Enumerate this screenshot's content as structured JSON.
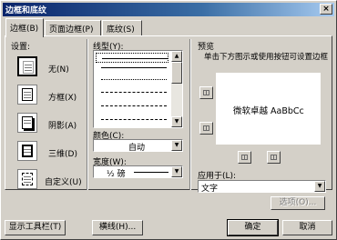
{
  "window": {
    "title": "边框和底纹",
    "close_glyph": "×"
  },
  "tabs": [
    {
      "label": "边框(B)"
    },
    {
      "label": "页面边框(P)"
    },
    {
      "label": "底纹(S)"
    }
  ],
  "settings": {
    "heading": "设置:",
    "items": [
      {
        "label": "无(N)"
      },
      {
        "label": "方框(X)"
      },
      {
        "label": "阴影(A)"
      },
      {
        "label": "三维(D)"
      },
      {
        "label": "自定义(U)"
      }
    ]
  },
  "line_style": {
    "label": "线型(Y):",
    "color_label": "颜色(C):",
    "color_value": "自动",
    "width_label": "宽度(W):",
    "width_value": "½ 磅"
  },
  "preview": {
    "heading": "预览",
    "hint": "单击下方图示或使用按钮可设置边框",
    "sample_text": "微软卓越 AaBbCc"
  },
  "apply_to": {
    "label": "应用于(L):",
    "value": "文字",
    "options_button": "选项(O)..."
  },
  "footer": {
    "toolbar_button": "显示工具栏(T)",
    "hline_button": "横线(H)...",
    "ok_button": "确定",
    "cancel_button": "取消"
  },
  "colors": {
    "title_bar": "#0a246a",
    "face": "#d4d0c8"
  }
}
